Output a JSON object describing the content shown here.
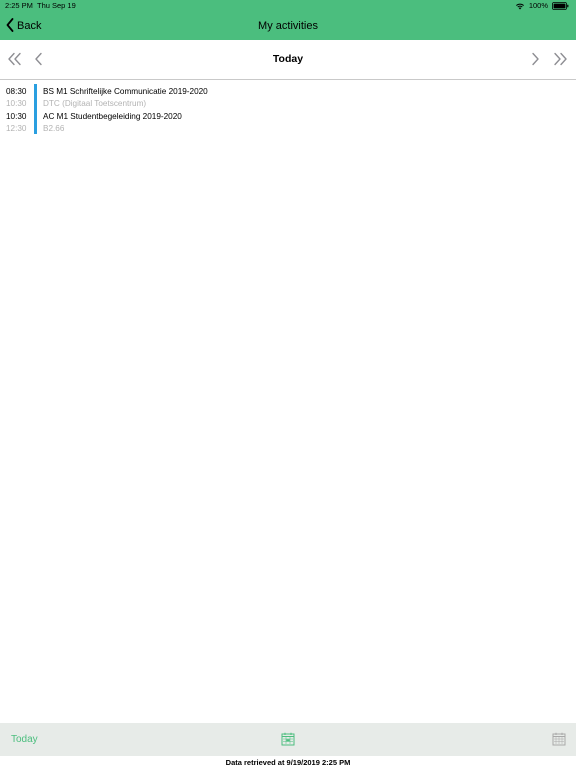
{
  "status_bar": {
    "time": "2:25 PM",
    "date": "Thu Sep 19",
    "battery": "100%",
    "icons": [
      "wifi-icon",
      "battery-icon"
    ]
  },
  "nav": {
    "back_label": "Back",
    "title": "My activities"
  },
  "date_nav": {
    "title": "Today",
    "icons": [
      "double-chevron-left-icon",
      "chevron-left-icon",
      "chevron-right-icon",
      "double-chevron-right-icon"
    ]
  },
  "activities": [
    {
      "start": "08:30",
      "end": "10:30",
      "title": "BS M1 Schriftelijke Communicatie 2019-2020",
      "location": "DTC (Digitaal Toetscentrum)"
    },
    {
      "start": "10:30",
      "end": "12:30",
      "title": "AC M1 Studentbegeleiding 2019-2020",
      "location": "B2.66"
    }
  ],
  "toolbar": {
    "today_label": "Today",
    "icons": [
      "calendar-day-icon",
      "calendar-grid-icon"
    ]
  },
  "footer": {
    "text": "Data retrieved at 9/19/2019 2:25 PM"
  },
  "colors": {
    "header_green": "#4bbe7e",
    "activity_bar": "#2a9fe0",
    "toolbar_bg": "#e7ebe8",
    "secondary_text": "#b3b3b3",
    "nav_arrow": "#8e8e93"
  }
}
